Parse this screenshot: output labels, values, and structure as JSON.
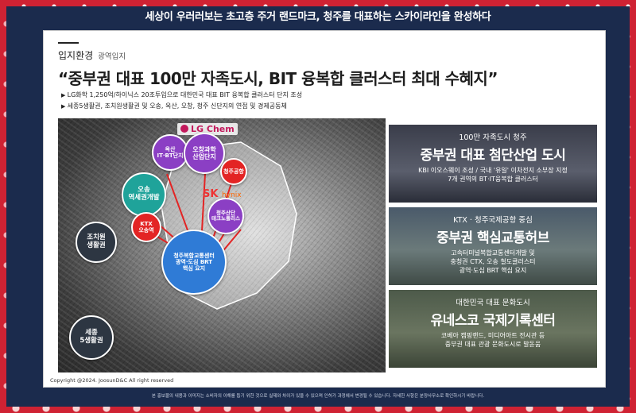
{
  "banner": {
    "text_pre": "세상이 우러러보는 초고층 주거 랜드마크, ",
    "text_hl": "청주를 대표하는",
    "text_post": " 스카이라인을 완성하다"
  },
  "section": {
    "title": "입지환경",
    "subtitle": "광역입지"
  },
  "headline": "“중부권 대표 100만 자족도시, BIT 융복합 클러스터 최대 수혜지”",
  "bullets": [
    "LG화학 1,250억/하이닉스 20조투입으로 대한민국 대표 BIT 융복합 클러스터 단지 조성",
    "세종5생활권, 조치원생활권 및 오송, 옥산, 오창, 청주 신단지의 연접 및 경제공동체"
  ],
  "map": {
    "lg_label": "LG Chem",
    "sk_label": "SK",
    "sk_sub": "hynix",
    "bubbles": [
      {
        "label": "옥산\nIT·BT단지"
      },
      {
        "label": "오창과학\n산업단지"
      },
      {
        "label": "청주공항"
      },
      {
        "label": "오송\n역세권개발"
      },
      {
        "label": "KTX\n오송역"
      },
      {
        "label": "청주산단\n테크노폴리스"
      },
      {
        "label": "조치원\n생활권"
      },
      {
        "label": "청주복합교통센터\n광역·도심 BRT\n핵심 요지"
      },
      {
        "label": "세종\n5생활권"
      }
    ]
  },
  "copyright": "Copyright @2024. JoosunD&C All right reserved",
  "cards": [
    {
      "kicker": "100만 자족도시 청주",
      "title": "중부권 대표 첨단산업 도시",
      "desc": [
        "KBI 이오스웨이 조성 / 국내 '유일' 이차전지 소부장 지정",
        "7개 권역의 BT·IT융복합 클러스터"
      ]
    },
    {
      "kicker": "KTX · 청주국제공항 중심",
      "title": "중부권 핵심교통허브",
      "desc": [
        "고속터미널복합교통센터개발 및",
        "충청권 CTX, 오송 철도클러스터",
        "광역·도심 BRT 핵심 요지"
      ]
    },
    {
      "kicker": "대한민국 대표 문화도시",
      "title": "유네스코 국제기록센터",
      "desc": [
        "코베아 캠핑랜드, 미디어아트 전시관 등",
        "중부권 대표 관광 문화도시로 발돋움"
      ]
    }
  ],
  "bottom_note": "본 홍보물의 내용과 이미지는 소비자의 이해를 돕기 위한 것으로 실제와 차이가 있을 수 있으며 인허가 과정에서 변경될 수 있습니다. 자세한 사항은 분양사무소로 확인하시기 바랍니다.",
  "colors": {
    "frame": "#1b2b4d",
    "border_red": "#cf2233",
    "purple": "#8b3fc4",
    "teal": "#1fa39a",
    "red": "#e32424",
    "dark": "#2d3642",
    "blue": "#2f7bd6"
  }
}
